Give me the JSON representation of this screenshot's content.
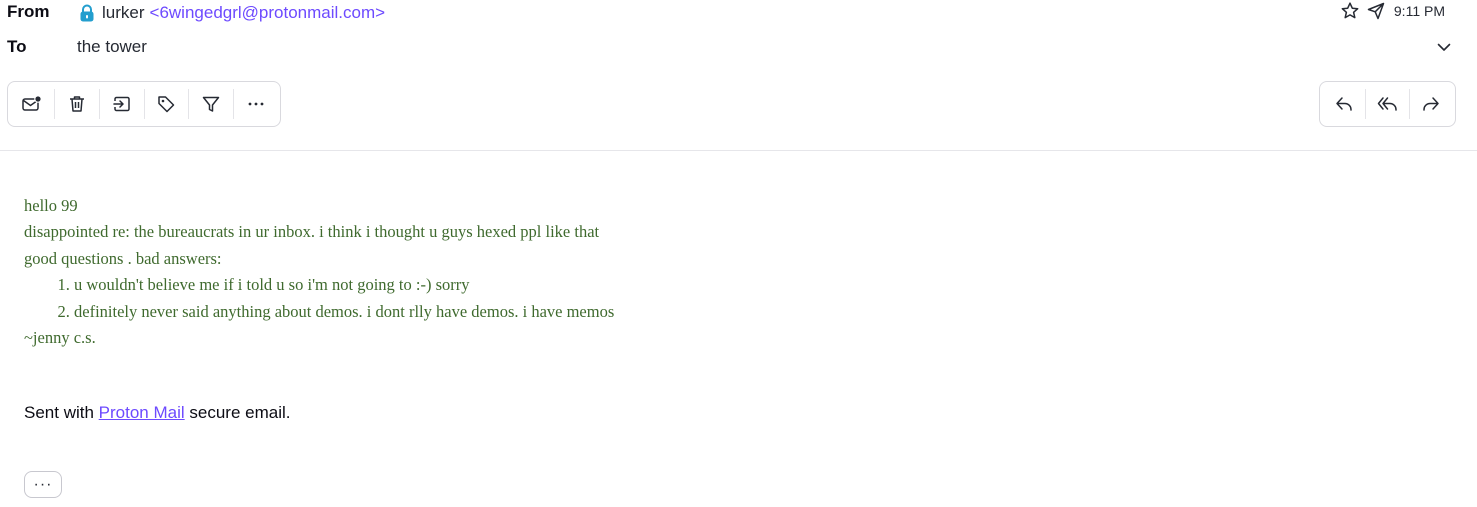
{
  "header": {
    "from_label": "From",
    "to_label": "To",
    "sender_name": "lurker",
    "sender_email": "<6wingedgrl@protonmail.com>",
    "recipient": "the tower",
    "time": "9:11 PM"
  },
  "toolbar_left": [
    {
      "icon": "mark-unread-icon"
    },
    {
      "icon": "trash-icon"
    },
    {
      "icon": "move-to-icon"
    },
    {
      "icon": "label-icon"
    },
    {
      "icon": "filter-icon"
    },
    {
      "icon": "more-options-icon"
    }
  ],
  "toolbar_right": [
    {
      "icon": "reply-icon"
    },
    {
      "icon": "reply-all-icon"
    },
    {
      "icon": "forward-icon"
    }
  ],
  "message": {
    "greeting": "hello 99",
    "line1": "disappointed re: the bureaucrats in ur inbox. i think i thought u guys hexed ppl like that",
    "line2": "good questions . bad answers:",
    "items": [
      "u wouldn't believe me if i told u so i'm not going to :-) sorry",
      "definitely never said anything about demos. i dont rlly have demos. i have memos"
    ],
    "signoff": "~jenny c.s."
  },
  "signature": {
    "prefix": "Sent with",
    "link": "Proton Mail",
    "suffix": "secure email."
  },
  "expand_button": "···",
  "colors": {
    "accent": "#6d4aff",
    "body_text": "#3f6a2e",
    "lock": "#239ece"
  }
}
